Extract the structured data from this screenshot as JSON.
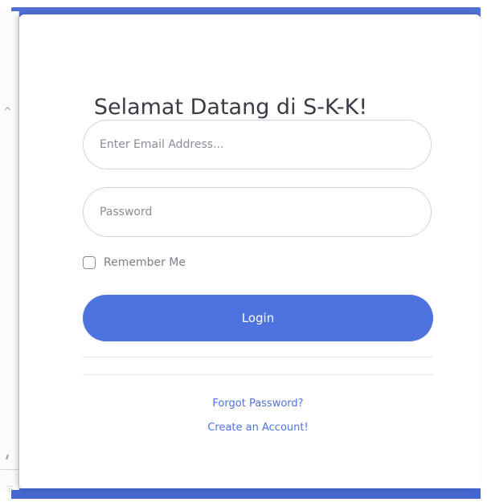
{
  "login": {
    "title": "Selamat Datang di S-K-K!",
    "email_placeholder": "Enter Email Address...",
    "email_value": "",
    "password_placeholder": "Password",
    "password_value": "",
    "remember_label": "Remember Me",
    "login_label": "Login",
    "forgot_label": "Forgot Password?",
    "create_label": "Create an Account!"
  },
  "colors": {
    "primary": "#4e73df",
    "title_text": "#3a3b45",
    "muted_text": "#7b7d89",
    "border": "#d1d3e2"
  }
}
